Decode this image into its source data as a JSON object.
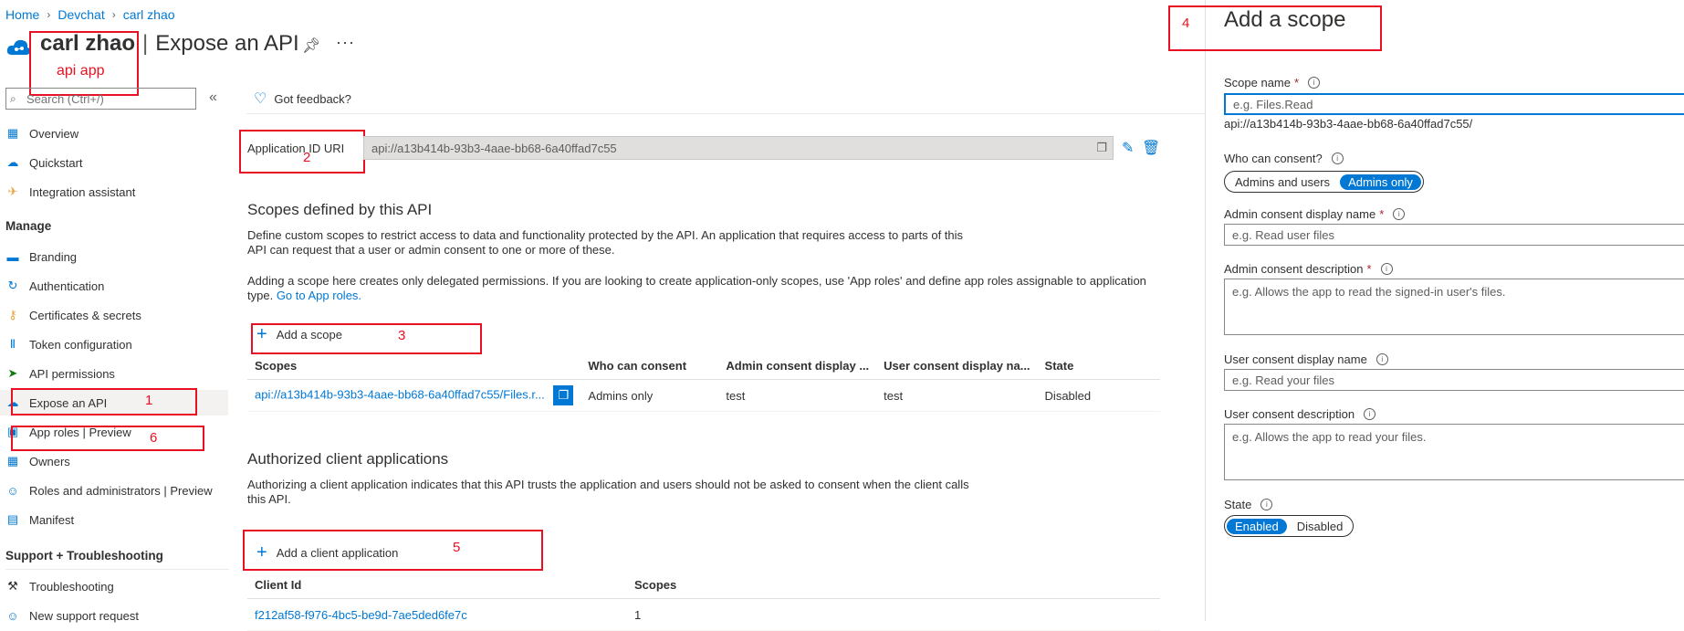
{
  "breadcrumb": [
    "Home",
    "Devchat",
    "carl zhao"
  ],
  "header": {
    "app_name": "carl zhao",
    "page": "Expose an API",
    "tag": "api app"
  },
  "search": {
    "placeholder": "Search (Ctrl+/)"
  },
  "sidebar": {
    "items_top": [
      {
        "label": "Overview",
        "icon": "overview-icon"
      },
      {
        "label": "Quickstart",
        "icon": "quickstart-icon"
      },
      {
        "label": "Integration assistant",
        "icon": "rocket-icon"
      }
    ],
    "manage_heading": "Manage",
    "manage_items": [
      {
        "label": "Branding",
        "icon": "branding-icon"
      },
      {
        "label": "Authentication",
        "icon": "authentication-icon"
      },
      {
        "label": "Certificates & secrets",
        "icon": "key-icon"
      },
      {
        "label": "Token configuration",
        "icon": "token-icon"
      },
      {
        "label": "API permissions",
        "icon": "permissions-icon"
      },
      {
        "label": "Expose an API",
        "icon": "cloud-icon"
      },
      {
        "label": "App roles | Preview",
        "icon": "app-roles-icon"
      },
      {
        "label": "Owners",
        "icon": "owners-icon"
      },
      {
        "label": "Roles and administrators | Preview",
        "icon": "roles-icon"
      },
      {
        "label": "Manifest",
        "icon": "manifest-icon"
      }
    ],
    "support_heading": "Support + Troubleshooting",
    "support_items": [
      {
        "label": "Troubleshooting",
        "icon": "wrench-icon"
      },
      {
        "label": "New support request",
        "icon": "support-icon"
      }
    ]
  },
  "main": {
    "feedback": "Got feedback?",
    "app_id_label": "Application ID URI",
    "app_id_value": "api://a13b414b-93b3-4aae-bb68-6a40ffad7c55",
    "scopes_heading": "Scopes defined by this API",
    "scopes_desc1": "Define custom scopes to restrict access to data and functionality protected by the API. An application that requires access to parts of this API can request that a user or admin consent to one or more of these.",
    "scopes_desc2": "Adding a scope here creates only delegated permissions. If you are looking to create application-only scopes, use 'App roles' and define app roles assignable to application type.",
    "scopes_desc2_link": "Go to App roles.",
    "add_scope": "Add a scope",
    "scopes_table": {
      "headers": [
        "Scopes",
        "Who can consent",
        "Admin consent display ...",
        "User consent display na...",
        "State"
      ],
      "rows": [
        [
          "api://a13b414b-93b3-4aae-bb68-6a40ffad7c55/Files.r...",
          "Admins only",
          "test",
          "test",
          "Disabled"
        ]
      ]
    },
    "clients_heading": "Authorized client applications",
    "clients_desc": "Authorizing a client application indicates that this API trusts the application and users should not be asked to consent when the client calls this API.",
    "add_client": "Add a client application",
    "clients_table": {
      "headers": [
        "Client Id",
        "Scopes"
      ],
      "rows": [
        [
          "f212af58-f976-4bc5-be9d-7ae5ded6fe7c",
          "1"
        ]
      ]
    }
  },
  "panel": {
    "title": "Add a scope",
    "scope_name_label": "Scope name",
    "scope_name_placeholder": "e.g. Files.Read",
    "scope_prefix": "api://a13b414b-93b3-4aae-bb68-6a40ffad7c55/",
    "who_label": "Who can consent?",
    "who_options": [
      "Admins and users",
      "Admins only"
    ],
    "admin_display_label": "Admin consent display name",
    "admin_display_placeholder": "e.g. Read user files",
    "admin_desc_label": "Admin consent description",
    "admin_desc_placeholder": "e.g. Allows the app to read the signed-in user's files.",
    "user_display_label": "User consent display name",
    "user_display_placeholder": "e.g. Read your files",
    "user_desc_label": "User consent description",
    "user_desc_placeholder": "e.g. Allows the app to read your files.",
    "state_label": "State",
    "state_options": [
      "Enabled",
      "Disabled"
    ]
  },
  "annotations": [
    "1",
    "2",
    "3",
    "4",
    "5",
    "6"
  ],
  "colors": {
    "accent": "#0078d4",
    "annotation": "#e81123"
  }
}
